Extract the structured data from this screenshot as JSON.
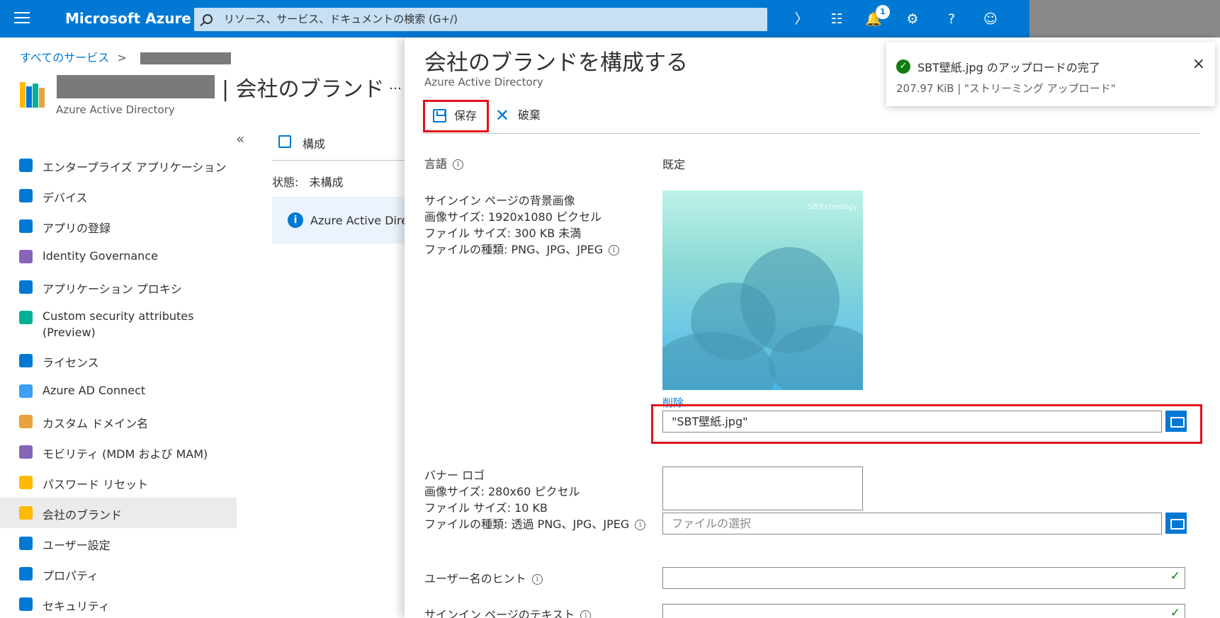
{
  "topbar": {
    "brand": "Microsoft Azure",
    "search_placeholder": "リソース、サービス、ドキュメントの検索 (G+/)",
    "notification_count": "1"
  },
  "breadcrumb": {
    "root": "すべてのサービス",
    "separator": ">"
  },
  "blade": {
    "title": "| 会社のブランド",
    "subtitle": "Azure Active Directory",
    "more": "…",
    "collapse": "«"
  },
  "sidebar": {
    "items": [
      {
        "label": "エンタープライズ アプリケーション",
        "icon": "enterprise-apps-icon",
        "color": "#0078d4"
      },
      {
        "label": "デバイス",
        "icon": "devices-icon",
        "color": "#0078d4"
      },
      {
        "label": "アプリの登録",
        "icon": "app-registrations-icon",
        "color": "#0078d4"
      },
      {
        "label": "Identity Governance",
        "icon": "identity-governance-icon",
        "color": "#8764b8"
      },
      {
        "label": "アプリケーション プロキシ",
        "icon": "app-proxy-icon",
        "color": "#0078d4"
      },
      {
        "label": "Custom security attributes (Preview)",
        "icon": "security-attributes-icon",
        "color": "#00b294"
      },
      {
        "label": "ライセンス",
        "icon": "licenses-icon",
        "color": "#0078d4"
      },
      {
        "label": "Azure AD Connect",
        "icon": "ad-connect-icon",
        "color": "#3aa0f3"
      },
      {
        "label": "カスタム ドメイン名",
        "icon": "custom-domain-icon",
        "color": "#e8a33d"
      },
      {
        "label": "モビリティ (MDM および MAM)",
        "icon": "mobility-icon",
        "color": "#8764b8"
      },
      {
        "label": "パスワード リセット",
        "icon": "password-reset-icon",
        "color": "#ffb900"
      },
      {
        "label": "会社のブランド",
        "icon": "company-branding-icon",
        "color": "#ffb900",
        "selected": true
      },
      {
        "label": "ユーザー設定",
        "icon": "user-settings-icon",
        "color": "#0078d4"
      },
      {
        "label": "プロパティ",
        "icon": "properties-icon",
        "color": "#0078d4"
      },
      {
        "label": "セキュリティ",
        "icon": "security-icon",
        "color": "#0078d4"
      }
    ]
  },
  "middle": {
    "configure": "構成",
    "state_label": "状態:",
    "state_value": "未構成",
    "info_text": "Azure Active Directory"
  },
  "panel": {
    "title": "会社のブランドを構成する",
    "subtitle": "Azure Active Directory",
    "save": "保存",
    "discard": "破棄",
    "language_label": "言語",
    "language_value": "既定",
    "bg_label_1": "サインイン ページの背景画像",
    "bg_label_2": "画像サイズ: 1920x1080 ピクセル",
    "bg_label_3": "ファイル サイズ: 300 KB 未満",
    "bg_label_4": "ファイルの種類: PNG、JPG、JPEG",
    "bg_image_brand": "SBTechnology",
    "delete_link": "削除",
    "bg_file_value": "\"SBT壁紙.jpg\"",
    "banner_label_1": "バナー ロゴ",
    "banner_label_2": "画像サイズ: 280x60 ピクセル",
    "banner_label_3": "ファイル サイズ: 10 KB",
    "banner_label_4": "ファイルの種類: 透過 PNG、JPG、JPEG",
    "banner_file_placeholder": "ファイルの選択",
    "username_hint_label": "ユーザー名のヒント",
    "signin_text_label": "サインイン ページのテキスト"
  },
  "toast": {
    "title": "SBT壁紙.jpg のアップロードの完了",
    "message": "207.97 KiB | \"ストリーミング アップロード\"",
    "close": "×"
  }
}
